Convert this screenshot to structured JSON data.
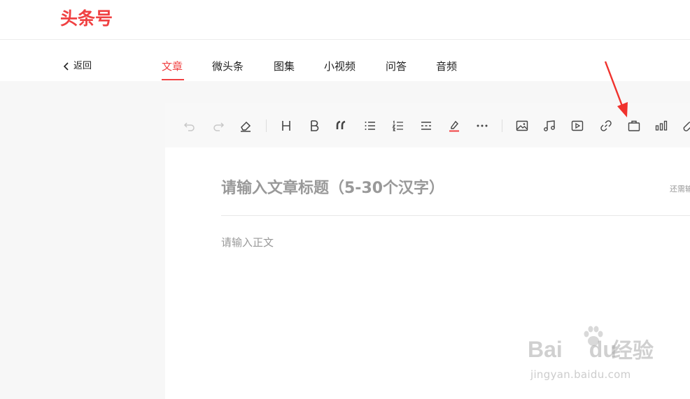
{
  "header": {
    "logo": "头条号"
  },
  "nav": {
    "back_label": "返回",
    "tabs": [
      {
        "label": "文章",
        "active": true
      },
      {
        "label": "微头条",
        "active": false
      },
      {
        "label": "图集",
        "active": false
      },
      {
        "label": "小视频",
        "active": false
      },
      {
        "label": "问答",
        "active": false
      },
      {
        "label": "音频",
        "active": false
      }
    ]
  },
  "toolbar": {
    "icons": [
      "undo-icon",
      "redo-icon",
      "eraser-icon",
      "heading-icon",
      "bold-icon",
      "quote-icon",
      "bullet-list-icon",
      "ordered-list-icon",
      "divider-icon",
      "highlight-icon",
      "more-icon",
      "image-icon",
      "music-icon",
      "video-icon",
      "link-icon",
      "shopping-bag-icon",
      "chart-icon",
      "link-partial-icon"
    ]
  },
  "editor": {
    "title_placeholder": "请输入文章标题（5-30个汉字）",
    "title_hint": "还需输",
    "body_placeholder": "请输入正文"
  },
  "watermark": {
    "brand": "Bai",
    "brand_suffix": "du",
    "product": "经验",
    "url": "jingyan.baidu.com"
  },
  "colors": {
    "accent": "#f04142",
    "annotation_arrow": "#f0322d"
  }
}
